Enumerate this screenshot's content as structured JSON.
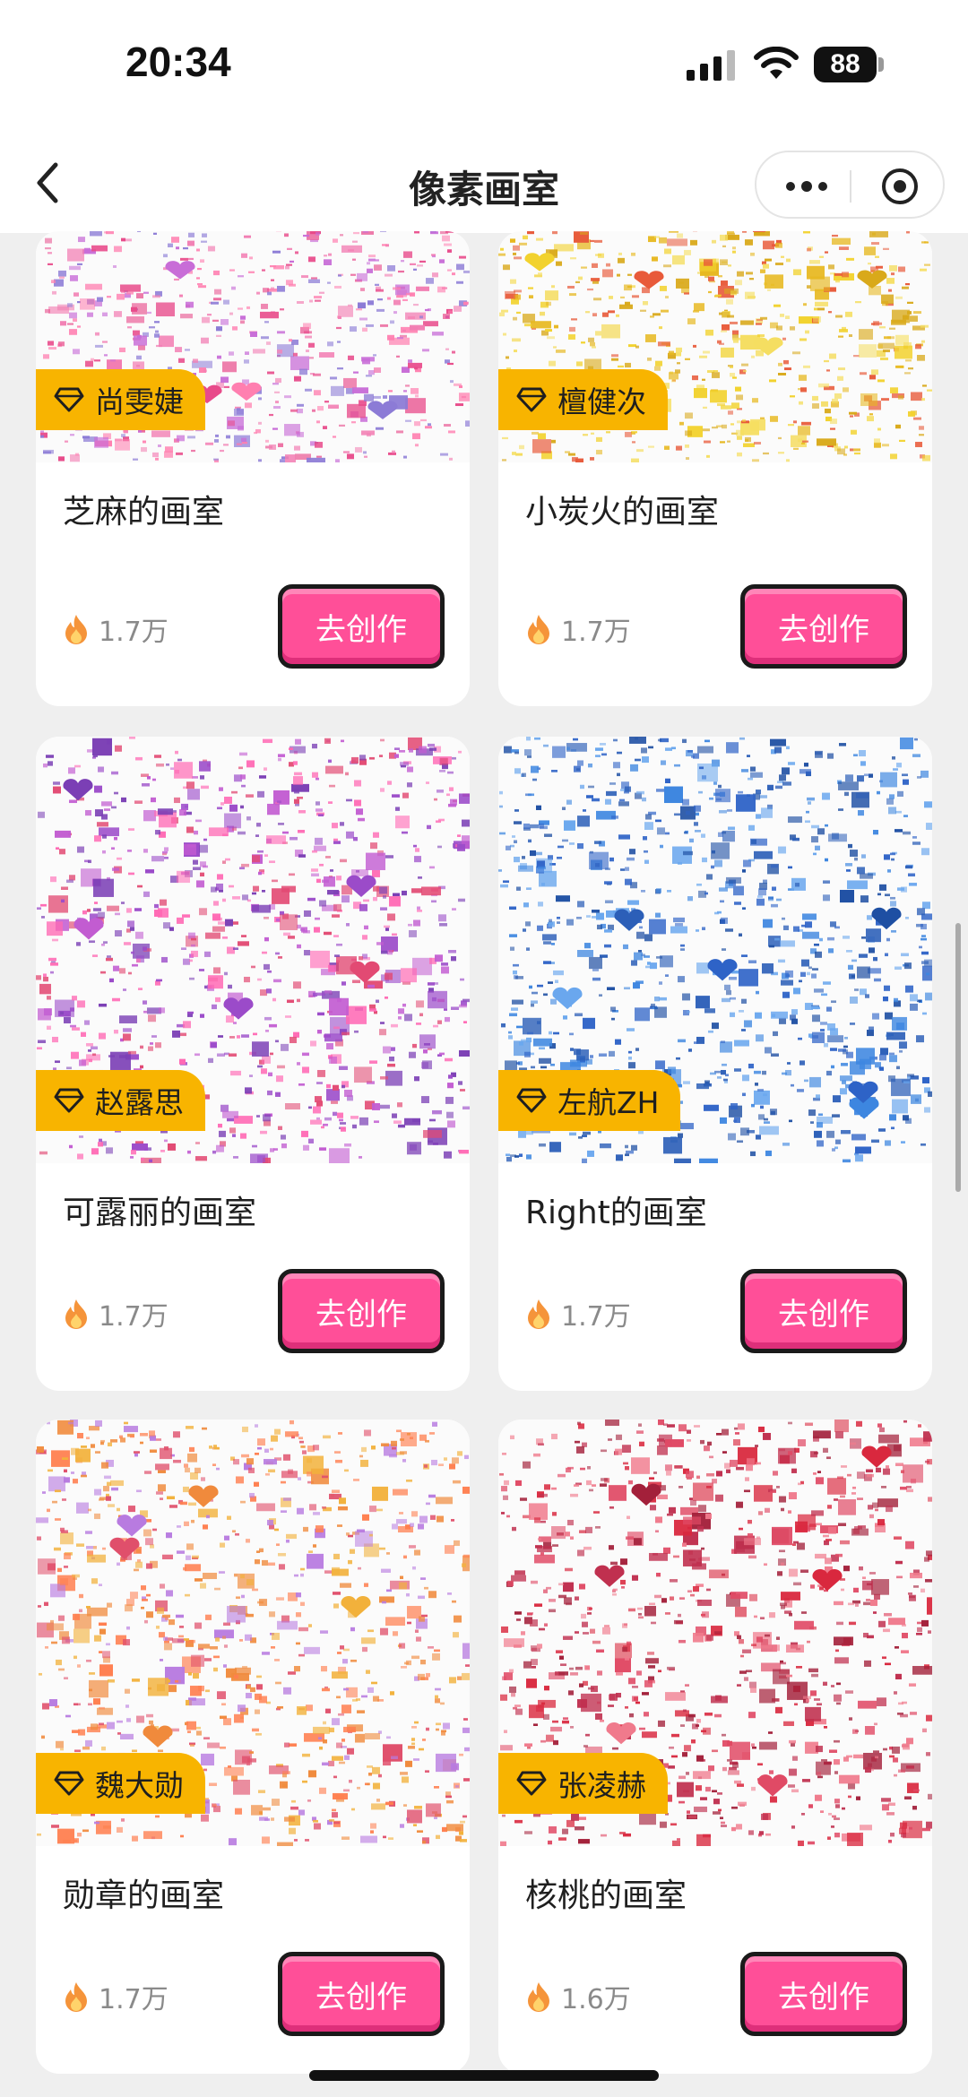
{
  "status_bar": {
    "time": "20:34",
    "battery": "88"
  },
  "nav": {
    "title": "像素画室"
  },
  "button_label": "去创作",
  "colors": {
    "accent": "#ff4f98",
    "tag": "#f8b400",
    "background": "#efefef"
  },
  "cards": [
    {
      "creator": "尚雯婕",
      "name": "芝麻的画室",
      "heat": "1.7万",
      "palette": [
        "#e84a8a",
        "#c86dd7",
        "#ff7fb0",
        "#8c7bd6",
        "#f27eb3"
      ]
    },
    {
      "creator": "檀健次",
      "name": "小炭火的画室",
      "heat": "1.7万",
      "palette": [
        "#f2d22e",
        "#e7b81f",
        "#f5de61",
        "#d9a91a",
        "#e85a3a"
      ]
    },
    {
      "creator": "赵露思",
      "name": "可露丽的画室",
      "heat": "1.7万",
      "palette": [
        "#9b4bc9",
        "#c25cd1",
        "#e24a73",
        "#7b3fb5",
        "#ff69b4"
      ]
    },
    {
      "creator": "左航ZH",
      "name": "Right的画室",
      "heat": "1.7万",
      "palette": [
        "#2e63c7",
        "#3d86e0",
        "#1e4fa3",
        "#6aa7ee",
        "#2c5fb8"
      ]
    },
    {
      "creator": "魏大勋",
      "name": "勋章的画室",
      "heat": "1.7万",
      "palette": [
        "#f08a3c",
        "#f2b13b",
        "#e04f6b",
        "#b87be0",
        "#ff7f50"
      ]
    },
    {
      "creator": "张凌赫",
      "name": "核桃的画室",
      "heat": "1.6万",
      "palette": [
        "#d9283e",
        "#e04a65",
        "#a3203a",
        "#f07a8c",
        "#c0304f"
      ]
    }
  ]
}
